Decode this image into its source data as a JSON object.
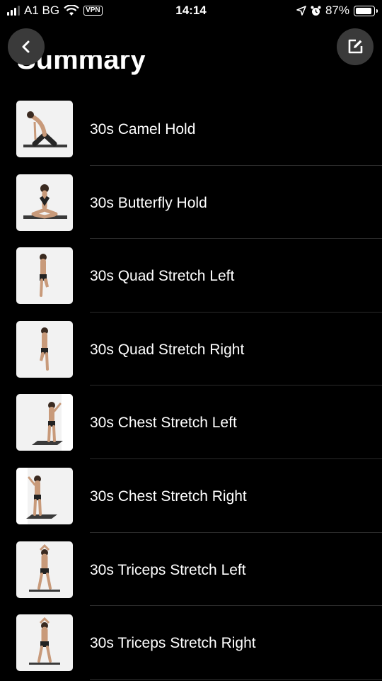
{
  "status_bar": {
    "carrier": "A1 BG",
    "vpn_label": "VPN",
    "time": "14:14",
    "battery_percent": "87%",
    "battery_level": 0.87,
    "signal_bars_on": 3,
    "signal_bars_total": 4
  },
  "header": {
    "title": "Summary",
    "back_icon": "chevron-left-icon",
    "edit_icon": "edit-icon"
  },
  "exercises": [
    {
      "label": "30s Camel Hold"
    },
    {
      "label": "30s Butterfly Hold"
    },
    {
      "label": "30s Quad Stretch Left"
    },
    {
      "label": "30s Quad Stretch Right"
    },
    {
      "label": "30s Chest Stretch Left"
    },
    {
      "label": "30s Chest Stretch Right"
    },
    {
      "label": "30s Triceps Stretch Left"
    },
    {
      "label": "30s Triceps Stretch Right"
    }
  ],
  "colors": {
    "background": "#000000",
    "button_bg": "#3a3a3a",
    "thumbnail_bg": "#f2f2f2",
    "divider": "#2b2b2b"
  }
}
